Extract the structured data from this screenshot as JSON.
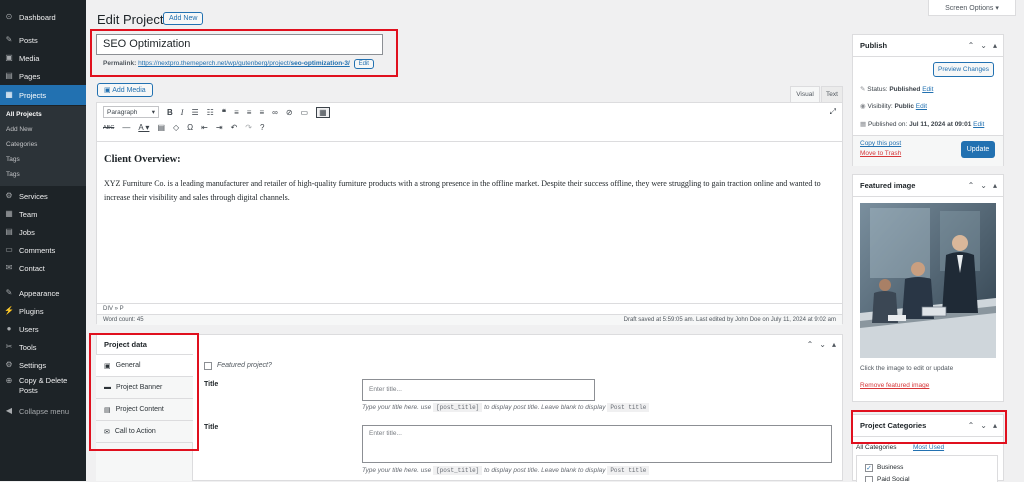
{
  "sidebar": {
    "items": [
      {
        "label": "Dashboard",
        "icon": "dashboard-icon",
        "glyph": "⊙"
      },
      {
        "label": "Posts",
        "icon": "pushpin-icon",
        "glyph": "✎"
      },
      {
        "label": "Media",
        "icon": "media-icon",
        "glyph": "▣"
      },
      {
        "label": "Pages",
        "icon": "page-icon",
        "glyph": "▤"
      },
      {
        "label": "Projects",
        "icon": "projects-icon",
        "glyph": "▦"
      },
      {
        "label": "Services",
        "icon": "gear-icon",
        "glyph": "⚙"
      },
      {
        "label": "Team",
        "icon": "team-icon",
        "glyph": "▦"
      },
      {
        "label": "Jobs",
        "icon": "jobs-icon",
        "glyph": "▤"
      },
      {
        "label": "Comments",
        "icon": "comment-icon",
        "glyph": "▭"
      },
      {
        "label": "Contact",
        "icon": "mail-icon",
        "glyph": "✉"
      },
      {
        "label": "Appearance",
        "icon": "brush-icon",
        "glyph": "✎"
      },
      {
        "label": "Plugins",
        "icon": "plugin-icon",
        "glyph": "⚡"
      },
      {
        "label": "Users",
        "icon": "user-icon",
        "glyph": "●"
      },
      {
        "label": "Tools",
        "icon": "wrench-icon",
        "glyph": "✂"
      },
      {
        "label": "Settings",
        "icon": "settings-icon",
        "glyph": "⚙"
      },
      {
        "label": "Copy & Delete Posts",
        "icon": "copy-icon",
        "glyph": "⊕"
      },
      {
        "label": "Collapse menu",
        "icon": "collapse-icon",
        "glyph": "◀"
      }
    ],
    "sub": [
      "All Projects",
      "Add New",
      "Categories",
      "Tags",
      "Tags"
    ]
  },
  "header": {
    "title": "Edit Project",
    "add_new": "Add New",
    "screen_options": "Screen Options ▾"
  },
  "post": {
    "title": "SEO Optimization",
    "permalink_label": "Permalink:",
    "permalink_base": "https://nextpro.themeperch.net/wp/gutenberg/project/",
    "permalink_slug": "seo-optimization-3/",
    "edit": "Edit"
  },
  "editor": {
    "add_media": "Add Media",
    "tab_visual": "Visual",
    "tab_text": "Text",
    "format": "Paragraph",
    "heading": "Client Overview:",
    "body": "XYZ Furniture Co. is a leading manufacturer and retailer of high-quality furniture products with a strong presence in the offline market. Despite their success offline, they were struggling to gain traction online and wanted to increase their visibility and sales through digital channels.",
    "path": "DIV » P",
    "word_count": "Word count: 45",
    "draft_saved": "Draft saved at 5:59:05 am. Last edited by John Doe on July 11, 2024 at 9:02 am"
  },
  "publish": {
    "title": "Publish",
    "preview": "Preview Changes",
    "status_label": "Status:",
    "status_value": "Published",
    "visibility_label": "Visibility:",
    "visibility_value": "Public",
    "published_label": "Published on:",
    "published_value": "Jul 11, 2024 at 09:01",
    "edit": "Edit",
    "copy": "Copy this post",
    "trash": "Move to Trash",
    "update": "Update"
  },
  "featured": {
    "title": "Featured image",
    "hint": "Click the image to edit or update",
    "remove": "Remove featured image"
  },
  "categories": {
    "title": "Project Categories",
    "tab_all": "All Categories",
    "tab_used": "Most Used",
    "items": [
      "Business",
      "Paid Social"
    ]
  },
  "project_data": {
    "title": "Project data",
    "tabs": [
      "General",
      "Project Banner",
      "Project Content",
      "Call to Action"
    ],
    "featured_label": "Featured project?",
    "title_label": "Title",
    "title_placeholder": "Enter title...",
    "help_pre": "Type your title here. use",
    "help_code": "[post_title]",
    "help_mid": "to display post title. Leave blank to display",
    "help_code2": "Post title"
  },
  "colors": {
    "accent": "#2271b1",
    "highlight": "#e0101e",
    "sidebar": "#1d2327"
  }
}
